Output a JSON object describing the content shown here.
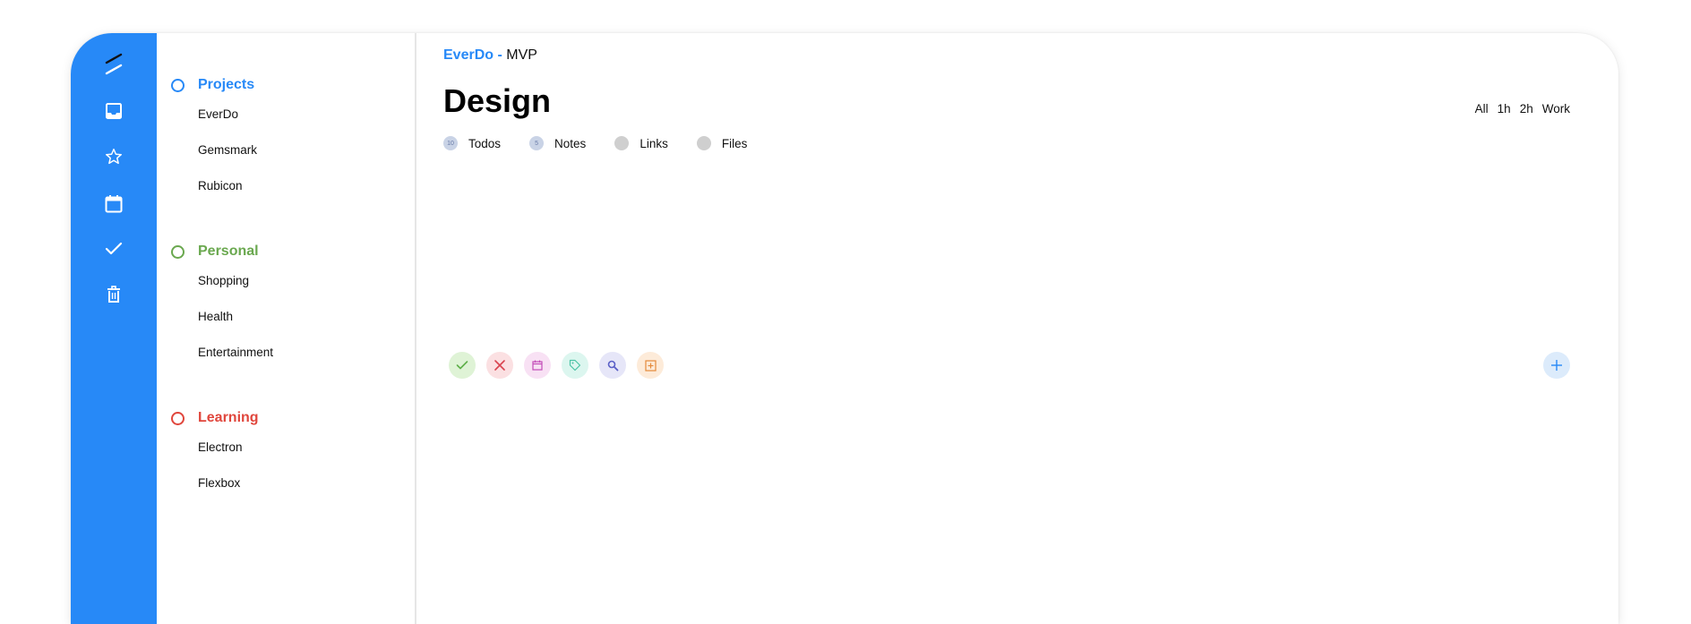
{
  "colors": {
    "accent": "#2789f7",
    "personal": "#6aa84f",
    "learning": "#e0463c"
  },
  "rail": {
    "items": [
      {
        "icon": "logo-slash-icon"
      },
      {
        "icon": "inbox-icon"
      },
      {
        "icon": "star-icon"
      },
      {
        "icon": "calendar-icon"
      },
      {
        "icon": "check-icon"
      },
      {
        "icon": "trash-icon"
      }
    ]
  },
  "sidebar": {
    "groups": [
      {
        "title": "Projects",
        "color": "#2789f7",
        "items": [
          "EverDo",
          "Gemsmark",
          "Rubicon"
        ]
      },
      {
        "title": "Personal",
        "color": "#6aa84f",
        "items": [
          "Shopping",
          "Health",
          "Entertainment"
        ]
      },
      {
        "title": "Learning",
        "color": "#e0463c",
        "items": [
          "Electron",
          "Flexbox"
        ]
      }
    ]
  },
  "header": {
    "project": "EverDo",
    "separator": "-",
    "subproject": "MVP",
    "title": "Design"
  },
  "filters": [
    "All",
    "1h",
    "2h",
    "Work"
  ],
  "tabs": [
    {
      "label": "Todos",
      "count": "10"
    },
    {
      "label": "Notes",
      "count": "5"
    },
    {
      "label": "Links",
      "count": ""
    },
    {
      "label": "Files",
      "count": ""
    }
  ],
  "toolbar": {
    "tools": [
      {
        "icon": "check-icon",
        "bg": "#dff3d6",
        "fg": "#5fb04a"
      },
      {
        "icon": "close-icon",
        "bg": "#fbe0e2",
        "fg": "#d9434f"
      },
      {
        "icon": "calendar-icon",
        "bg": "#f8e1f4",
        "fg": "#c44cb8"
      },
      {
        "icon": "tag-icon",
        "bg": "#dcf6ef",
        "fg": "#4cc3a6"
      },
      {
        "icon": "search-icon",
        "bg": "#e6e6f8",
        "fg": "#5a5fc7"
      },
      {
        "icon": "add-box-icon",
        "bg": "#fdebd9",
        "fg": "#e58a3c"
      }
    ],
    "add_icon": "plus-icon"
  }
}
